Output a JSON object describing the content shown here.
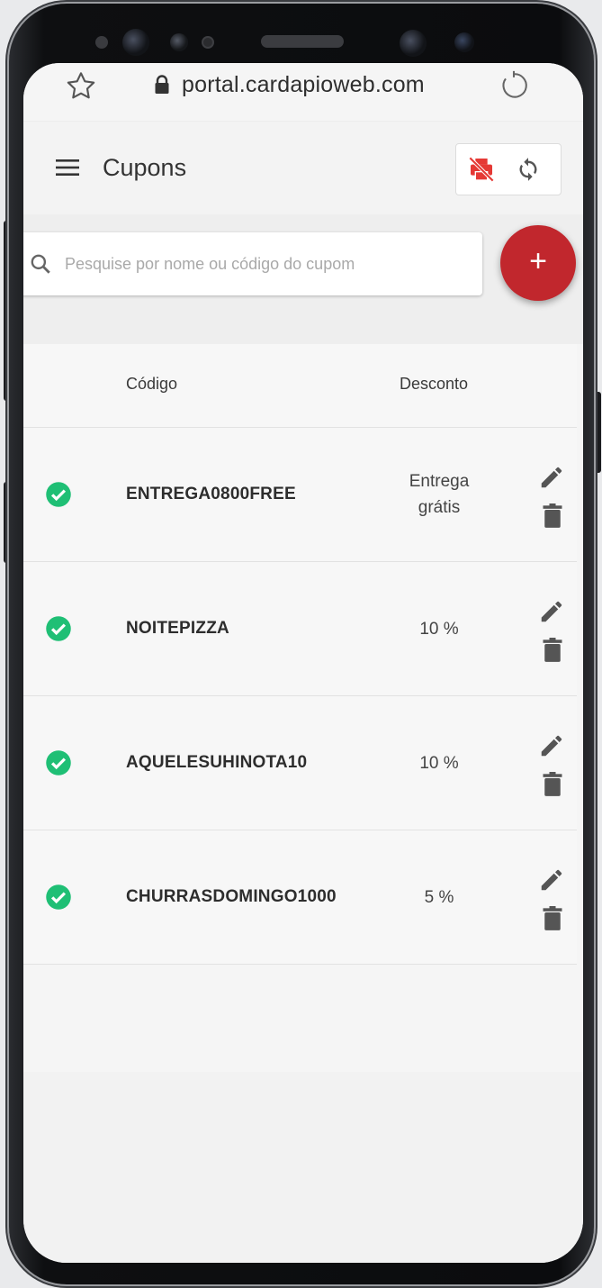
{
  "browser": {
    "url": "portal.cardapioweb.com"
  },
  "appbar": {
    "title": "Cupons"
  },
  "search": {
    "placeholder": "Pesquise por nome ou código do cupom",
    "add_label": "+"
  },
  "table": {
    "headers": {
      "code": "Código",
      "discount": "Desconto"
    },
    "rows": [
      {
        "code": "ENTREGA0800FREE",
        "discount_line1": "Entrega",
        "discount_line2": "grátis",
        "active": true
      },
      {
        "code": "NOITEPIZZA",
        "discount_line1": "10 %",
        "discount_line2": "",
        "active": true
      },
      {
        "code": "AQUELESUHINOTA10",
        "discount_line1": "10 %",
        "discount_line2": "",
        "active": true
      },
      {
        "code": "CHURRASDOMINGO1000",
        "discount_line1": "5 %",
        "discount_line2": "",
        "active": true
      }
    ]
  },
  "colors": {
    "accent": "#c1272d",
    "active": "#1fbf75",
    "icon": "#555555",
    "printer_off": "#e53935"
  },
  "icons": [
    "star-icon",
    "lock-icon",
    "reload-icon",
    "menu-icon",
    "printer-off-icon",
    "sync-icon",
    "search-icon",
    "check-circle-icon",
    "edit-icon",
    "delete-icon"
  ]
}
